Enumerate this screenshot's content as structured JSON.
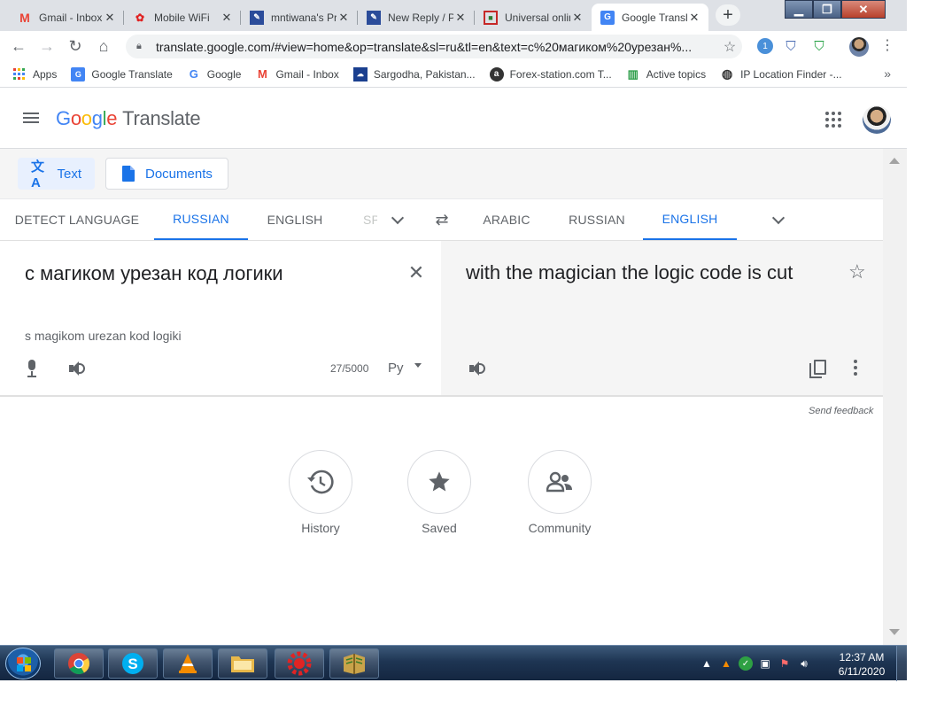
{
  "browser": {
    "tabs": [
      {
        "title": "Gmail - Inbox",
        "icon": "gmail-icon",
        "active": false
      },
      {
        "title": "Mobile WiFi",
        "icon": "huawei-icon",
        "active": false
      },
      {
        "title": "mntiwana's Profile",
        "icon": "forum-icon",
        "active": false
      },
      {
        "title": "New Reply / Posting",
        "icon": "forum-icon",
        "active": false
      },
      {
        "title": "Universal online",
        "icon": "universal-icon",
        "active": false
      },
      {
        "title": "Google Translate",
        "icon": "google-translate-icon",
        "active": true
      }
    ],
    "close_glyph": "✕",
    "new_tab_glyph": "+",
    "window_buttons": {
      "minimize": "▁",
      "maximize": "❐",
      "close": "✕"
    },
    "address": "translate.google.com/#view=home&op=translate&sl=ru&tl=en&text=с%20магиком%20урезан%...",
    "extension_badge": "1"
  },
  "bookmarks": [
    {
      "label": "Apps",
      "icon": "apps-grid-icon"
    },
    {
      "label": "Google Translate",
      "icon": "google-translate-icon"
    },
    {
      "label": "Google",
      "icon": "google-g-icon"
    },
    {
      "label": "Gmail - Inbox",
      "icon": "gmail-icon"
    },
    {
      "label": "Sargodha, Pakistan...",
      "icon": "weather-icon"
    },
    {
      "label": "Forex-station.com T...",
      "icon": "forex-icon"
    },
    {
      "label": "Active topics",
      "icon": "candles-icon"
    },
    {
      "label": "IP Location Finder -...",
      "icon": "globe-icon"
    }
  ],
  "bookmarks_more": "»",
  "header": {
    "logo_letters": [
      "G",
      "o",
      "o",
      "g",
      "l",
      "e"
    ],
    "product": "Translate"
  },
  "modes": {
    "text": "Text",
    "documents": "Documents"
  },
  "source_langs": [
    {
      "label": "DETECT LANGUAGE",
      "active": false
    },
    {
      "label": "RUSSIAN",
      "active": true
    },
    {
      "label": "ENGLISH",
      "active": false
    },
    {
      "label": "SP",
      "active": false
    }
  ],
  "target_langs": [
    {
      "label": "ARABIC",
      "active": false
    },
    {
      "label": "RUSSIAN",
      "active": false
    },
    {
      "label": "ENGLISH",
      "active": true
    }
  ],
  "source": {
    "text": "с магиком урезан код логики",
    "transliteration": "s magikom urezan kod logiki",
    "char_count": "27/5000",
    "keyboard_label": "Ру"
  },
  "target": {
    "text": "with the magician the logic code is cut"
  },
  "feedback": "Send feedback",
  "actions": [
    {
      "label": "History",
      "icon": "history-icon"
    },
    {
      "label": "Saved",
      "icon": "star-icon"
    },
    {
      "label": "Community",
      "icon": "community-icon"
    }
  ],
  "colors": {
    "accent": "#1a73e8",
    "text": "#202124",
    "muted": "#5f6368"
  },
  "taskbar": {
    "time": "12:37 AM",
    "date": "6/11/2020"
  }
}
